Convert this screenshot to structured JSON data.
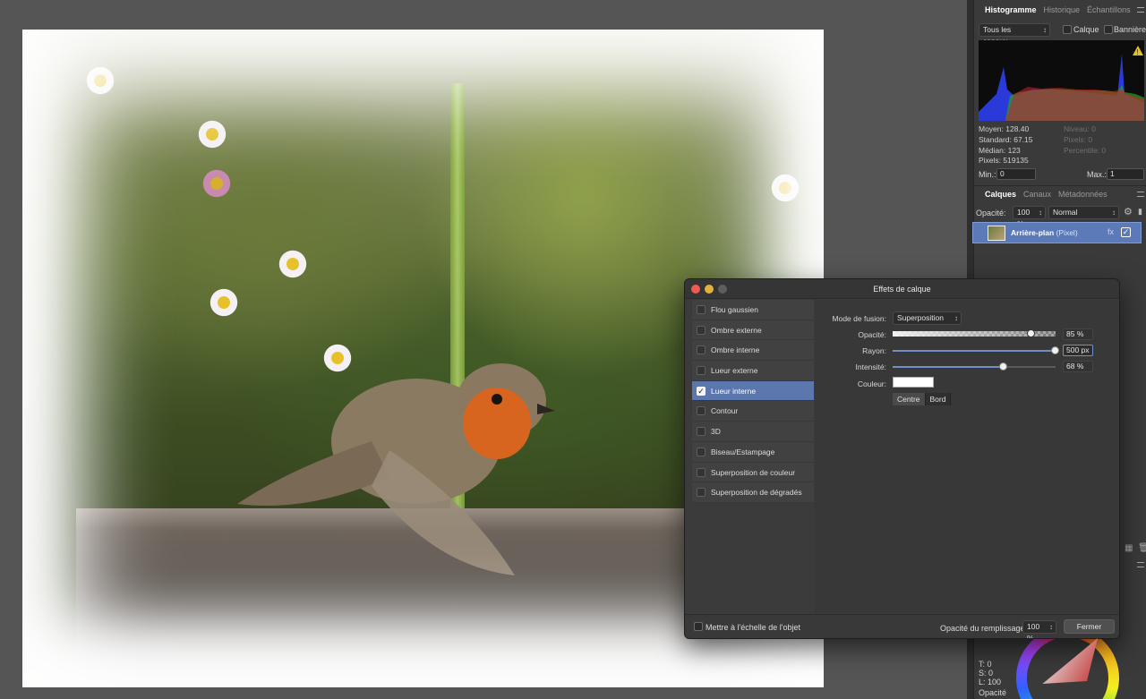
{
  "histogram_panel": {
    "tabs": [
      "Histogramme",
      "Historique",
      "Échantillons"
    ],
    "channel_select": "Tous les canaux",
    "calque_label": "Calque",
    "banniere_label": "Bannière",
    "stats": {
      "moyen": "Moyen: 128.40",
      "standard": "Standard: 67.15",
      "median": "Médian: 123",
      "pixels": "Pixels: 519135",
      "niveau": "Niveau: 0",
      "pixels_right": "Pixels: 0",
      "percentile": "Percentile: 0"
    },
    "min_label": "Min.:",
    "min_value": "0",
    "max_label": "Max.:",
    "max_value": "1"
  },
  "layers_panel": {
    "tabs": [
      "Calques",
      "Canaux",
      "Métadonnées"
    ],
    "opacity_label": "Opacité:",
    "opacity_value": "100 %",
    "blend_mode": "Normal",
    "layer_name": "Arrière-plan",
    "layer_type": "(Pixel)"
  },
  "color_panel": {
    "t": "T: 0",
    "s": "S: 0",
    "l": "L: 100",
    "opacity_label": "Opacité"
  },
  "dialog": {
    "title": "Effets de calque",
    "effects": [
      {
        "label": "Flou gaussien",
        "checked": false
      },
      {
        "label": "Ombre externe",
        "checked": false
      },
      {
        "label": "Ombre interne",
        "checked": false
      },
      {
        "label": "Lueur externe",
        "checked": false
      },
      {
        "label": "Lueur interne",
        "checked": true
      },
      {
        "label": "Contour",
        "checked": false
      },
      {
        "label": "3D",
        "checked": false
      },
      {
        "label": "Biseau/Estampage",
        "checked": false
      },
      {
        "label": "Superposition de couleur",
        "checked": false
      },
      {
        "label": "Superposition de dégradés",
        "checked": false
      }
    ],
    "blend_label": "Mode de fusion:",
    "blend_value": "Superposition",
    "opacity_label": "Opacité:",
    "opacity_value": "85 %",
    "opacity_fraction": 0.85,
    "radius_label": "Rayon:",
    "radius_value": "500 px",
    "radius_fraction": 1.0,
    "intensity_label": "Intensité:",
    "intensity_value": "68 %",
    "intensity_fraction": 0.68,
    "color_label": "Couleur:",
    "color_value": "#ffffff",
    "segment": [
      "Centre",
      "Bord"
    ],
    "scale_label": "Mettre à l'échelle de l'objet",
    "fill_opacity_label": "Opacité du remplissage:",
    "fill_opacity_value": "100 %",
    "close_label": "Fermer"
  }
}
